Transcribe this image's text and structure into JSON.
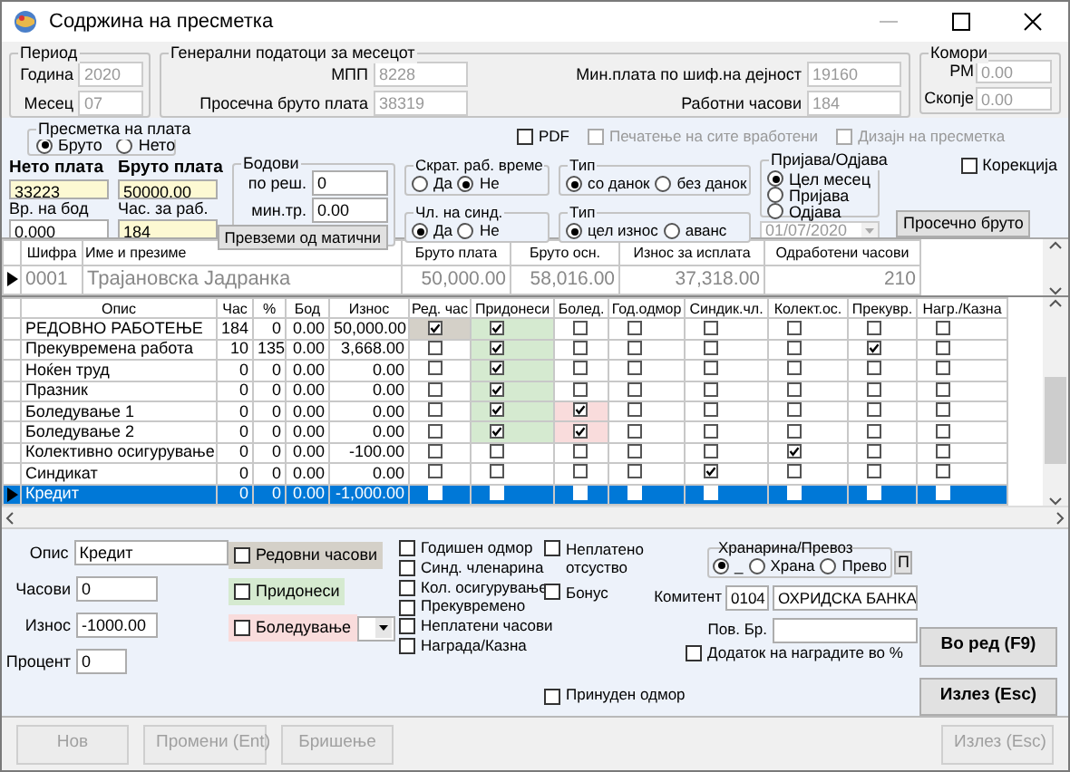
{
  "window": {
    "title": "Содржина на пресметка"
  },
  "period": {
    "title": "Период",
    "fields": [
      {
        "label": "Година",
        "value": "2020"
      },
      {
        "label": "Месец",
        "value": "07"
      }
    ]
  },
  "general": {
    "title": "Генерални податоци за месецот",
    "fields": [
      {
        "label": "МПП",
        "value": "8228"
      },
      {
        "label": "Мин.плата по шиф.на дејност",
        "value": "19160"
      },
      {
        "label": "Просечна бруто плата",
        "value": "38319"
      },
      {
        "label": "Работни часови",
        "value": "184"
      }
    ]
  },
  "chambers": {
    "title": "Комори",
    "fields": [
      {
        "label": "РМ",
        "value": "0.00"
      },
      {
        "label": "Скопје",
        "value": "0.00"
      }
    ]
  },
  "calc_type": {
    "title": "Пресметка на плата",
    "options": [
      {
        "label": "Бруто",
        "selected": true
      },
      {
        "label": "Нето",
        "selected": false
      }
    ]
  },
  "print_options": [
    {
      "label": "PDF",
      "checked": false,
      "disabled": false
    },
    {
      "label": "Печатење на сите вработени",
      "checked": false,
      "disabled": true
    },
    {
      "label": "Дизајн на пресметка",
      "checked": false,
      "disabled": true
    }
  ],
  "salary": [
    {
      "label": "Нето плата",
      "value": "33223",
      "kind": "highlight"
    },
    {
      "label": "Бруто плата",
      "value": "50000.00",
      "kind": "highlight"
    },
    {
      "label": "Вр. на бод",
      "value": "0.000",
      "kind": "plain"
    },
    {
      "label": "Час. за раб.",
      "value": "184",
      "kind": "highlight"
    }
  ],
  "points": {
    "title": "Бодови",
    "fields": [
      {
        "label": "по реш.",
        "value": "0"
      },
      {
        "label": "мин.тр.",
        "value": "0.00"
      }
    ],
    "button": "Превземи од матични"
  },
  "radio_groups": [
    {
      "title": "Скрат. раб. време",
      "options": [
        {
          "label": "Да",
          "selected": false
        },
        {
          "label": "Не",
          "selected": true
        }
      ]
    },
    {
      "title": "Чл. на синд.",
      "options": [
        {
          "label": "Да",
          "selected": true
        },
        {
          "label": "Не",
          "selected": false
        }
      ]
    },
    {
      "title": "Тип",
      "options": [
        {
          "label": "со данок",
          "selected": true
        },
        {
          "label": "без данок",
          "selected": false
        }
      ]
    },
    {
      "title": "Тип",
      "options": [
        {
          "label": "цел износ",
          "selected": true
        },
        {
          "label": "аванс",
          "selected": false
        }
      ]
    }
  ],
  "registration": {
    "title": "Пријава/Одјава",
    "options": [
      {
        "label": "Цел месец",
        "selected": true
      },
      {
        "label": "Пријава",
        "selected": false
      },
      {
        "label": "Одјава",
        "selected": false
      }
    ],
    "date": "01/07/2020",
    "button": "Просечно бруто"
  },
  "correction": {
    "label": "Корекција",
    "checked": false
  },
  "employees": {
    "columns": [
      "Шифра",
      "Име и презиме",
      "Бруто плата",
      "Бруто осн.",
      "Износ за исплата",
      "Одработени часови"
    ],
    "rows": [
      {
        "cells": [
          "0001",
          "Трајановска Јадранка",
          "50,000.00",
          "58,016.00",
          "37,318.00",
          "210"
        ],
        "selected": true
      }
    ]
  },
  "items": {
    "columns": [
      {
        "label": "Опис"
      },
      {
        "label": "Час"
      },
      {
        "label": "%"
      },
      {
        "label": "Бод"
      },
      {
        "label": "Износ"
      },
      {
        "label": "Ред. час",
        "color": "#d4d0c8"
      },
      {
        "label": "Придонеси",
        "color": "#d5ead0"
      },
      {
        "label": "Болед.",
        "color": "#f9dcdc"
      },
      {
        "label": "Год.одмор"
      },
      {
        "label": "Синдик.чл."
      },
      {
        "label": "Колект.ос."
      },
      {
        "label": "Прекувр."
      },
      {
        "label": "Нагр./Казна"
      }
    ],
    "rows": [
      {
        "cells": [
          "РЕДОВНО РАБОТЕЊЕ",
          "184",
          "0",
          "0.00",
          "50,000.00"
        ],
        "flags": [
          true,
          true,
          false,
          false,
          false,
          false,
          false,
          false
        ],
        "selected": false
      },
      {
        "cells": [
          "Прекувремена работа",
          "10",
          "135",
          "0.00",
          "3,668.00"
        ],
        "flags": [
          false,
          true,
          false,
          false,
          false,
          false,
          true,
          false
        ],
        "selected": false
      },
      {
        "cells": [
          "Ноќен труд",
          "0",
          "0",
          "0.00",
          "0.00"
        ],
        "flags": [
          false,
          true,
          false,
          false,
          false,
          false,
          false,
          false
        ],
        "selected": false
      },
      {
        "cells": [
          "Празник",
          "0",
          "0",
          "0.00",
          "0.00"
        ],
        "flags": [
          false,
          true,
          false,
          false,
          false,
          false,
          false,
          false
        ],
        "selected": false
      },
      {
        "cells": [
          "Боледување 1",
          "0",
          "0",
          "0.00",
          "0.00"
        ],
        "flags": [
          false,
          true,
          true,
          false,
          false,
          false,
          false,
          false
        ],
        "selected": false
      },
      {
        "cells": [
          "Боледување 2",
          "0",
          "0",
          "0.00",
          "0.00"
        ],
        "flags": [
          false,
          true,
          true,
          false,
          false,
          false,
          false,
          false
        ],
        "selected": false
      },
      {
        "cells": [
          "Колективно осигурување",
          "0",
          "0",
          "0.00",
          "-100.00"
        ],
        "flags": [
          false,
          false,
          false,
          false,
          false,
          true,
          false,
          false
        ],
        "selected": false
      },
      {
        "cells": [
          "Синдикат",
          "0",
          "0",
          "0.00",
          "0.00"
        ],
        "flags": [
          false,
          false,
          false,
          false,
          true,
          false,
          false,
          false
        ],
        "selected": false
      },
      {
        "cells": [
          "Кредит",
          "0",
          "0",
          "0.00",
          "-1,000.00"
        ],
        "flags": [
          false,
          false,
          false,
          false,
          false,
          false,
          false,
          false
        ],
        "selected": true
      }
    ]
  },
  "detail": {
    "fields": [
      {
        "label": "Опис",
        "value": "Кредит"
      },
      {
        "label": "Часови",
        "value": "0"
      },
      {
        "label": "Износ",
        "value": "-1000.00"
      },
      {
        "label": "Процент",
        "value": "0"
      }
    ],
    "flags": [
      {
        "label": "Редовни часови",
        "checked": false,
        "color": "#d4d0c8"
      },
      {
        "label": "Придонеси",
        "checked": false,
        "color": "#d5ead0"
      },
      {
        "label": "Боледување",
        "checked": false,
        "color": "#f9dcdc"
      }
    ],
    "options": [
      {
        "label": "Годишен одмор",
        "checked": false
      },
      {
        "label": "Синд. членарина",
        "checked": false
      },
      {
        "label": "Кол. осигурување",
        "checked": false
      },
      {
        "label": "Прекувремено",
        "checked": false
      },
      {
        "label": "Неплатени часови",
        "checked": false
      },
      {
        "label": "Награда/Казна",
        "checked": false
      }
    ],
    "extra_options": [
      {
        "label": "Неплатено отсуство",
        "checked": false
      },
      {
        "label": "Бонус",
        "checked": false
      }
    ],
    "forced_leave": {
      "label": "Принуден одмор",
      "checked": false
    },
    "food_transport": {
      "title": "Хранарина/Превоз",
      "options": [
        {
          "label": "_",
          "selected": true
        },
        {
          "label": "Храна",
          "selected": false
        },
        {
          "label": "Прево",
          "selected": false
        }
      ],
      "button": "П"
    },
    "client": {
      "label": "Комитент",
      "code": "0104",
      "name": "ОХРИДСКА БАНКА"
    },
    "reference": {
      "label": "Пов. Бр."
    },
    "bonus_percent": {
      "label": "Додаток на наградите во %",
      "checked": false
    }
  },
  "action_buttons": [
    {
      "label": "Во ред (F9)",
      "disabled": false
    },
    {
      "label": "Излез (Esc)",
      "disabled": false
    }
  ],
  "bottom_buttons": [
    {
      "label": "Нов",
      "disabled": true
    },
    {
      "label": "Промени (Ent)",
      "disabled": true
    },
    {
      "label": "Бришење",
      "disabled": true
    },
    {
      "label": "Излез (Esc)",
      "disabled": true
    }
  ]
}
